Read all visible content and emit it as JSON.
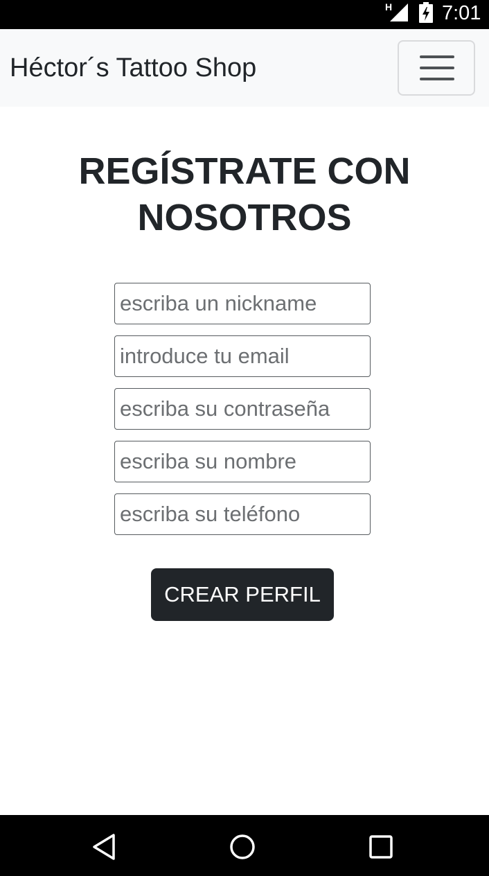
{
  "status_bar": {
    "network_label": "H",
    "time": "7:01",
    "icons": [
      "signal-icon",
      "battery-charging-icon"
    ]
  },
  "navbar": {
    "brand": "Héctor´s Tattoo Shop",
    "menu_icon": "hamburger-menu-icon"
  },
  "page": {
    "title_line1": "REGÍSTRATE CON",
    "title_line2": "NOSOTROS"
  },
  "form": {
    "nickname_placeholder": "escriba un nickname",
    "email_placeholder": "introduce tu email",
    "password_placeholder": "escriba su contraseña",
    "name_placeholder": "escriba su nombre",
    "phone_placeholder": "escriba su teléfono",
    "submit_label": "CREAR PERFIL"
  },
  "system_nav": {
    "icons": [
      "back-icon",
      "home-icon",
      "recents-icon"
    ]
  },
  "colors": {
    "navbar_bg": "#f8f9fa",
    "text": "#212529",
    "button_bg": "#212529",
    "button_text": "#ffffff"
  }
}
